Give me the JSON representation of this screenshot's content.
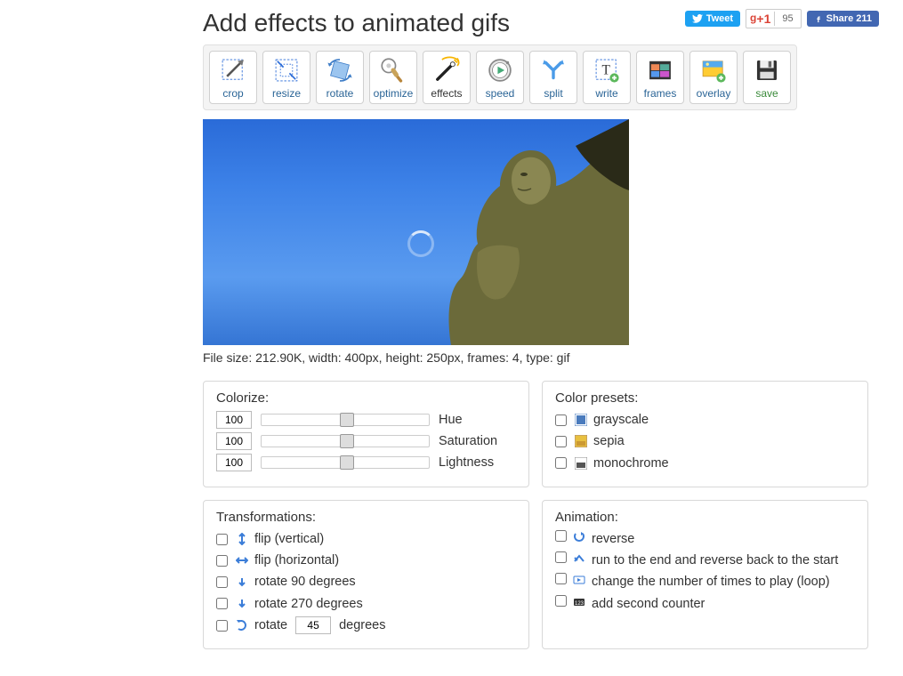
{
  "header": {
    "title": "Add effects to animated gifs",
    "tweet_label": "Tweet",
    "gplus_label": "+1",
    "gplus_count": "95",
    "fb_label": "Share",
    "fb_count": "211"
  },
  "toolbar": {
    "items": [
      {
        "id": "crop",
        "label": "crop"
      },
      {
        "id": "resize",
        "label": "resize"
      },
      {
        "id": "rotate",
        "label": "rotate"
      },
      {
        "id": "optimize",
        "label": "optimize"
      },
      {
        "id": "effects",
        "label": "effects",
        "active": true
      },
      {
        "id": "speed",
        "label": "speed"
      },
      {
        "id": "split",
        "label": "split"
      },
      {
        "id": "write",
        "label": "write"
      },
      {
        "id": "frames",
        "label": "frames"
      },
      {
        "id": "overlay",
        "label": "overlay"
      },
      {
        "id": "save",
        "label": "save",
        "accent": "green"
      }
    ]
  },
  "preview": {
    "file_size": "212.90K",
    "width_px": "400px",
    "height_px": "250px",
    "frames": "4",
    "type": "gif",
    "meta_line": "File size: 212.90K, width: 400px, height: 250px, frames: 4, type: gif"
  },
  "colorize": {
    "title": "Colorize:",
    "hue": {
      "value": "100",
      "label": "Hue"
    },
    "saturation": {
      "value": "100",
      "label": "Saturation"
    },
    "lightness": {
      "value": "100",
      "label": "Lightness"
    }
  },
  "presets": {
    "title": "Color presets:",
    "items": [
      {
        "id": "grayscale",
        "label": "grayscale"
      },
      {
        "id": "sepia",
        "label": "sepia"
      },
      {
        "id": "monochrome",
        "label": "monochrome"
      }
    ]
  },
  "transform": {
    "title": "Transformations:",
    "flip_v": "flip (vertical)",
    "flip_h": "flip (horizontal)",
    "rot90": "rotate 90 degrees",
    "rot270": "rotate 270 degrees",
    "rot_prefix": "rotate",
    "rot_value": "45",
    "rot_suffix": "degrees"
  },
  "animation": {
    "title": "Animation:",
    "reverse": "reverse",
    "boomerang": "run to the end and reverse back to the start",
    "loop": "change the number of times to play (loop)",
    "counter": "add second counter"
  }
}
